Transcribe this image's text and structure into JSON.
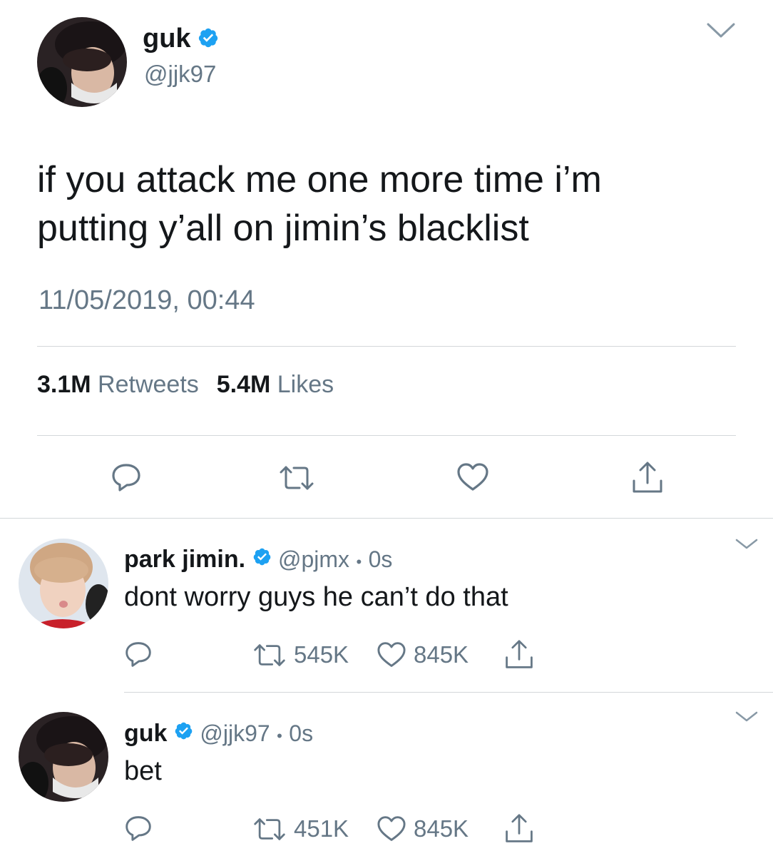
{
  "main_tweet": {
    "display_name": "guk",
    "handle": "@jjk97",
    "text_line1": "if you attack me one more time i’m",
    "text_line2": "putting y’all on jimin’s blacklist",
    "timestamp": "11/05/2019, 00:44",
    "retweets_count": "3.1M",
    "retweets_label": "Retweets",
    "likes_count": "5.4M",
    "likes_label": "Likes"
  },
  "replies": [
    {
      "display_name": "park jimin.",
      "handle": "@pjmx",
      "separator": "•",
      "time": "0s",
      "text": "dont worry guys he can’t do that",
      "retweets": "545K",
      "likes": "845K"
    },
    {
      "display_name": "guk",
      "handle": "@jjk97",
      "separator": "•",
      "time": "0s",
      "text": "bet",
      "retweets": "451K",
      "likes": "845K"
    }
  ],
  "colors": {
    "verified": "#1da1f2",
    "text": "#14171a",
    "secondary": "#657786",
    "divider": "#d3d7da"
  },
  "icons": [
    "chevron-down-icon",
    "verified-badge-icon",
    "reply-icon",
    "retweet-icon",
    "like-icon",
    "share-icon"
  ]
}
